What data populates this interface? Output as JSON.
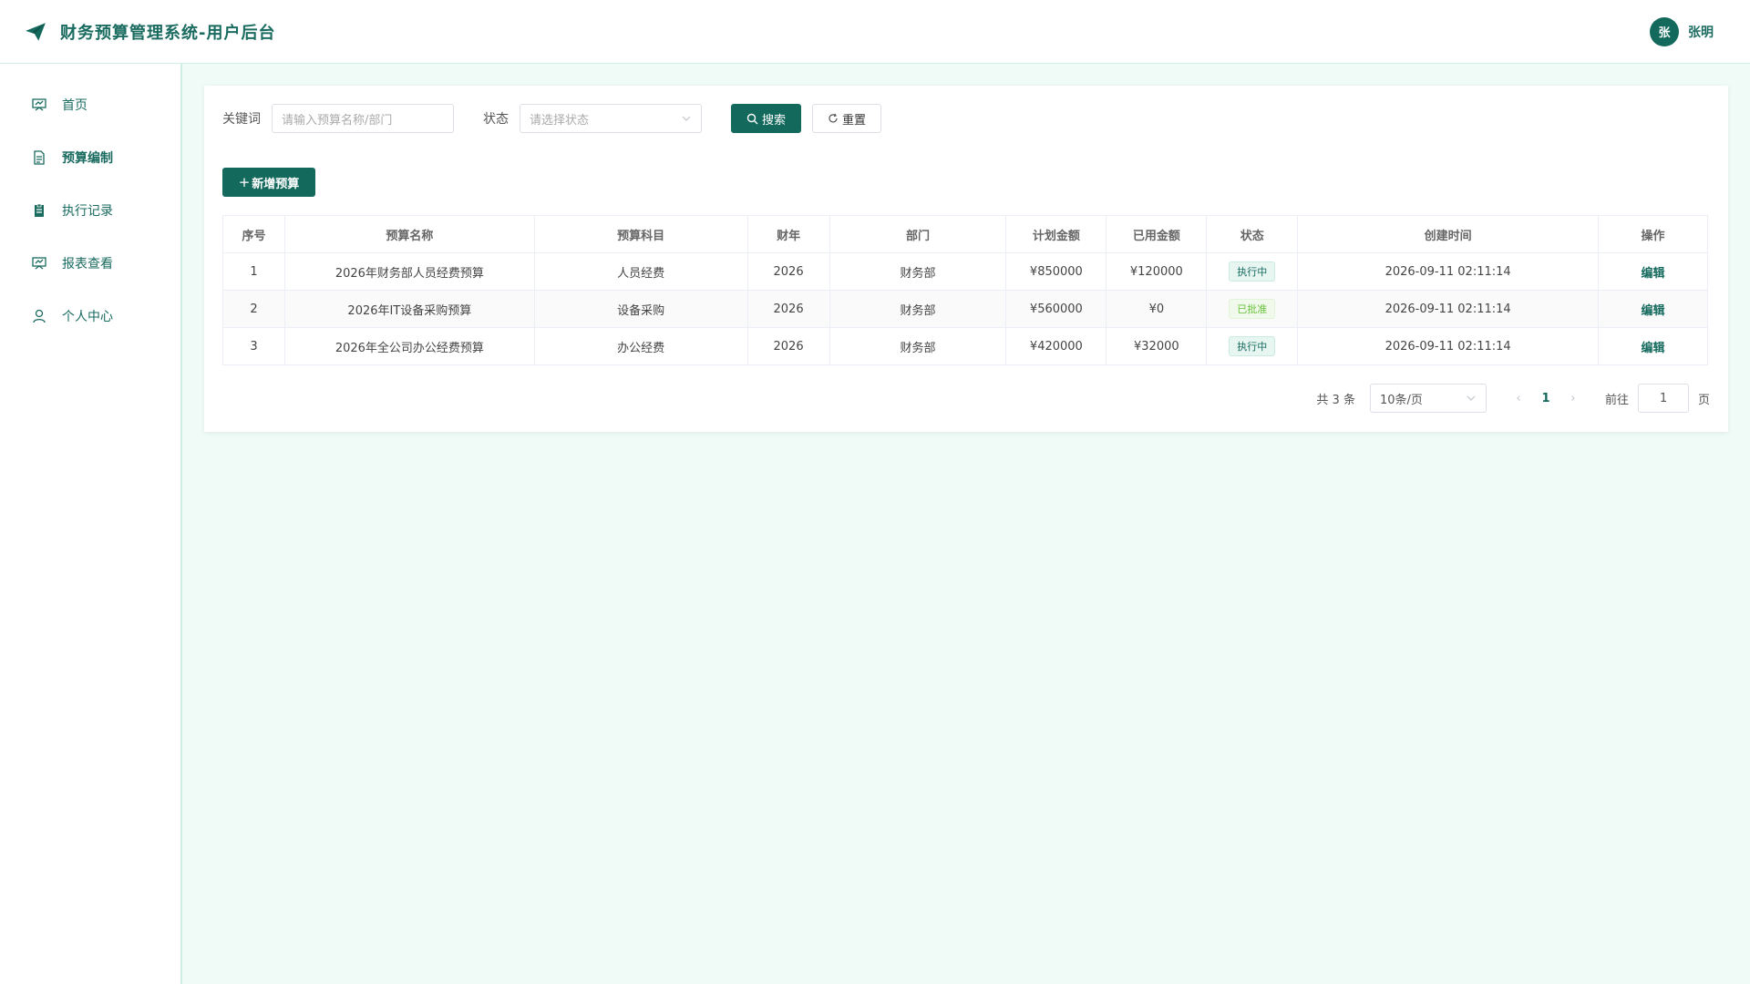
{
  "header": {
    "title": "财务预算管理系统-用户后台",
    "avatar_text": "张",
    "username": "张明"
  },
  "sidebar": {
    "items": [
      {
        "label": "首页",
        "icon": "dashboard-icon"
      },
      {
        "label": "预算编制",
        "icon": "document-icon"
      },
      {
        "label": "执行记录",
        "icon": "clipboard-icon"
      },
      {
        "label": "报表查看",
        "icon": "chart-board-icon"
      },
      {
        "label": "个人中心",
        "icon": "user-icon"
      }
    ]
  },
  "filters": {
    "keyword_label": "关键词",
    "keyword_placeholder": "请输入预算名称/部门",
    "status_label": "状态",
    "status_placeholder": "请选择状态",
    "search_label": "搜索",
    "reset_label": "重置"
  },
  "add_button": "新增预算",
  "table": {
    "headers": [
      "序号",
      "预算名称",
      "预算科目",
      "财年",
      "部门",
      "计划金额",
      "已用金额",
      "状态",
      "创建时间",
      "操作"
    ],
    "rows": [
      {
        "no": "1",
        "name": "2026年财务部人员经费预算",
        "subject": "人员经费",
        "year": "2026",
        "dept": "财务部",
        "plan": "¥850000",
        "used": "¥120000",
        "status": "执行中",
        "created": "2026-09-11 02:11:14",
        "action": "编辑"
      },
      {
        "no": "2",
        "name": "2026年IT设备采购预算",
        "subject": "设备采购",
        "year": "2026",
        "dept": "财务部",
        "plan": "¥560000",
        "used": "¥0",
        "status": "已批准",
        "created": "2026-09-11 02:11:14",
        "action": "编辑"
      },
      {
        "no": "3",
        "name": "2026年全公司办公经费预算",
        "subject": "办公经费",
        "year": "2026",
        "dept": "财务部",
        "plan": "¥420000",
        "used": "¥32000",
        "status": "执行中",
        "created": "2026-09-11 02:11:14",
        "action": "编辑"
      }
    ]
  },
  "pagination": {
    "total": "共 3 条",
    "page_size": "10条/页",
    "current_page": "1",
    "goto_label": "前往",
    "goto_value": "1",
    "page_suffix": "页"
  },
  "colors": {
    "primary": "#14695d",
    "background": "#f0fbf8",
    "success": "#67c23a"
  }
}
